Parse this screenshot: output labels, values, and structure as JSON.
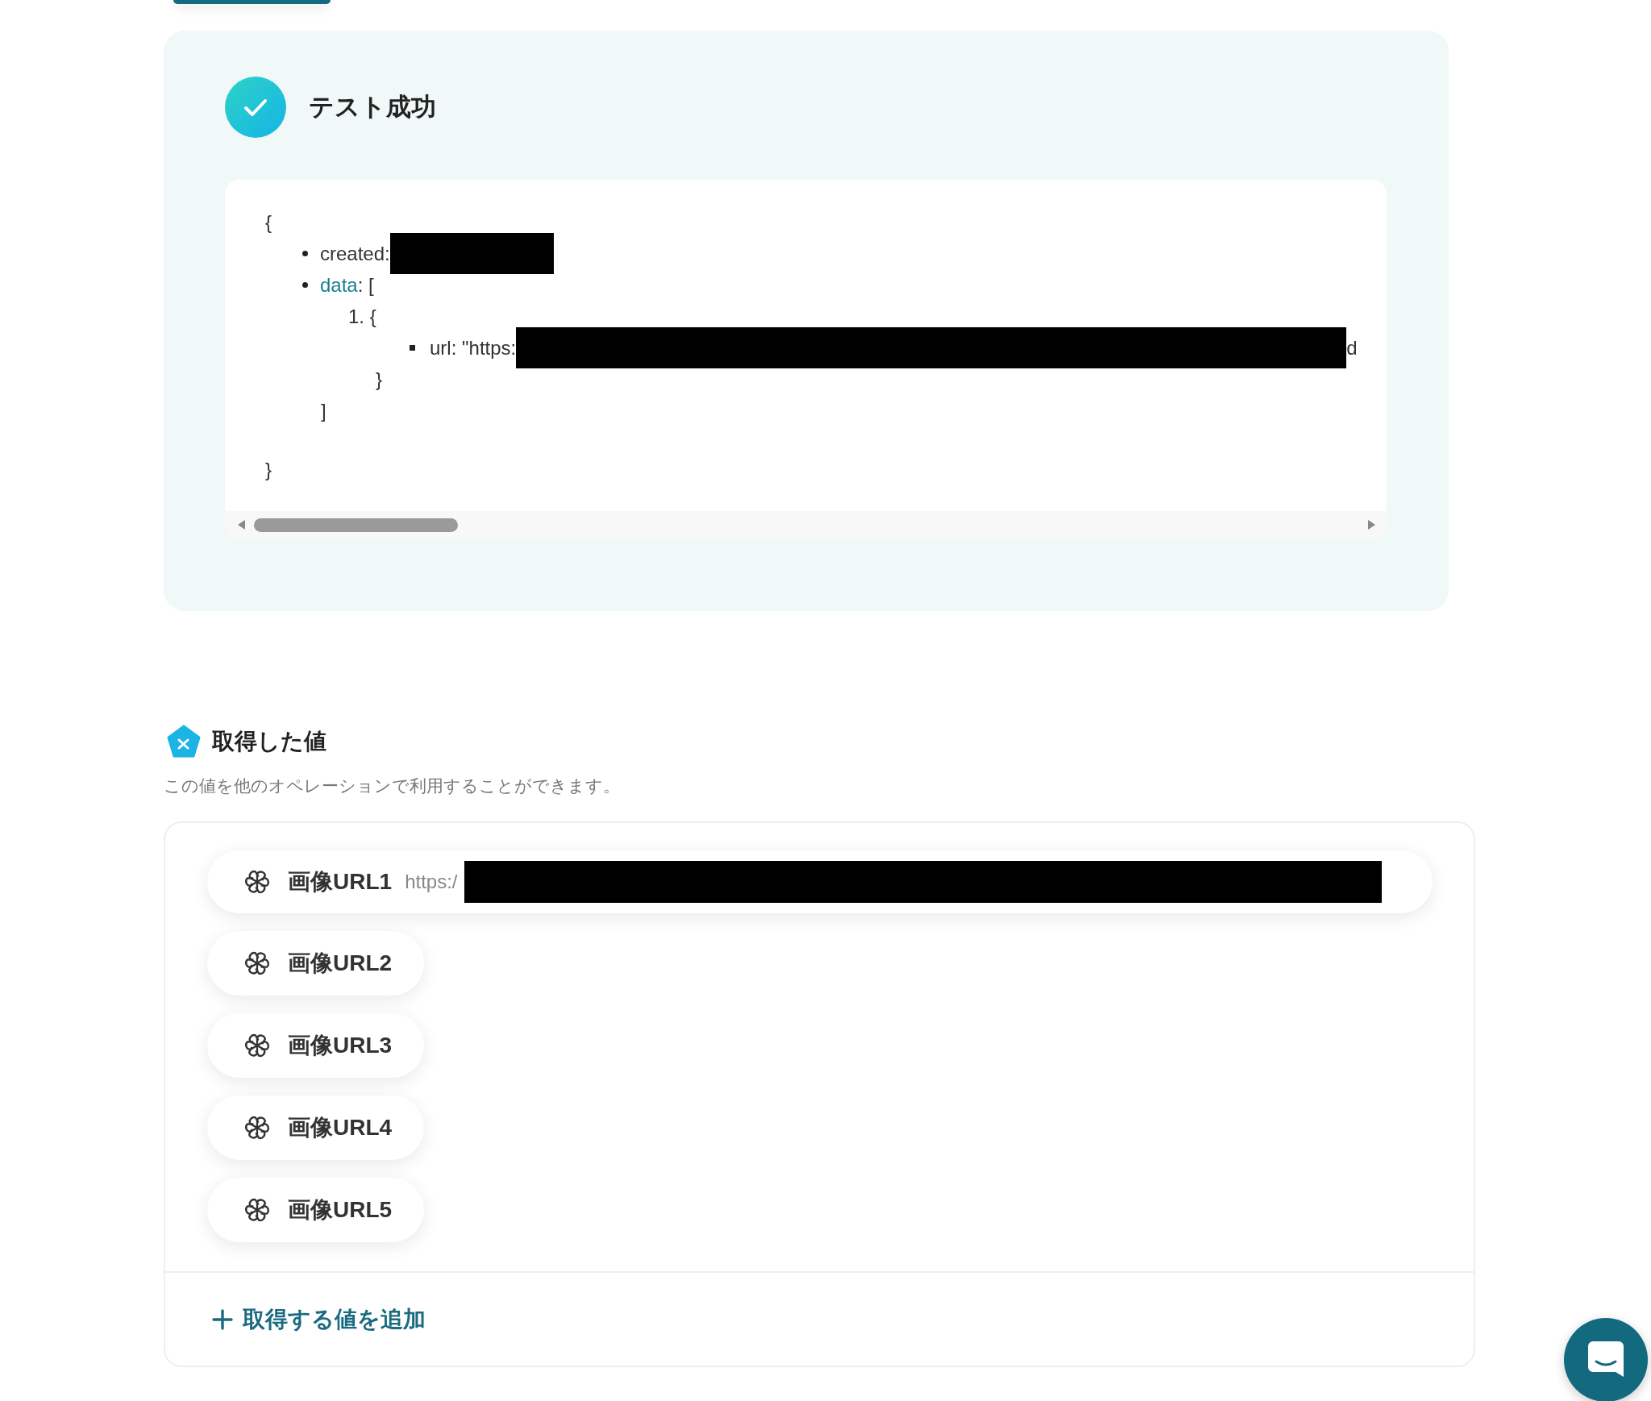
{
  "test_result": {
    "success": true,
    "title": "テスト成功",
    "response": {
      "open": "{",
      "close": "}",
      "items": [
        {
          "kind": "value",
          "key": "created:",
          "redacted": true
        },
        {
          "kind": "array",
          "key": "data",
          "suffix": ": [",
          "close": "]",
          "children": [
            {
              "marker": "1.",
              "open": "{",
              "close": "}",
              "children": [
                {
                  "kind": "value",
                  "key": "url: \"https:",
                  "redacted": true,
                  "tail": "d"
                }
              ]
            }
          ]
        }
      ]
    }
  },
  "obtained_values": {
    "title": "取得した値",
    "description": "この値を他のオペレーションで利用することができます。",
    "items": [
      {
        "label": "画像URL1",
        "value": "https:/",
        "redacted": true
      },
      {
        "label": "画像URL2"
      },
      {
        "label": "画像URL3"
      },
      {
        "label": "画像URL4"
      },
      {
        "label": "画像URL5"
      }
    ],
    "add_button": "取得する値を追加"
  }
}
